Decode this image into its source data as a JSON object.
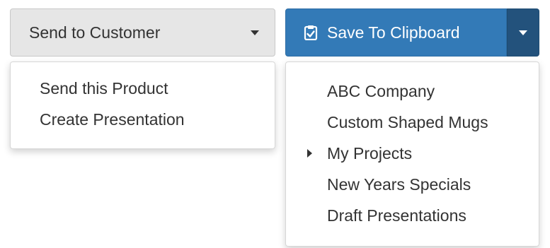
{
  "send_dropdown": {
    "button_label": "Send to Customer",
    "caret_icon": "chevron-down-icon",
    "items": [
      {
        "label": "Send this Product"
      },
      {
        "label": "Create Presentation"
      }
    ]
  },
  "save_dropdown": {
    "button_label": "Save To Clipboard",
    "button_icon": "clipboard-check-icon",
    "caret_icon": "chevron-down-icon",
    "items": [
      {
        "label": "ABC Company",
        "has_submenu": false
      },
      {
        "label": "Custom Shaped Mugs",
        "has_submenu": false
      },
      {
        "label": "My Projects",
        "has_submenu": true
      },
      {
        "label": "New Years Specials",
        "has_submenu": false
      },
      {
        "label": "Draft Presentations",
        "has_submenu": false
      }
    ]
  },
  "colors": {
    "primary": "#337ab7",
    "primary_dark": "#23527c",
    "default_button": "#e6e6e6",
    "text": "#333333"
  }
}
